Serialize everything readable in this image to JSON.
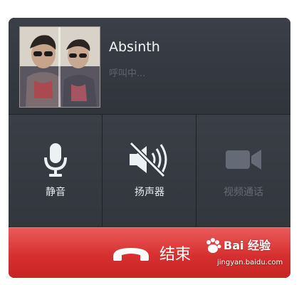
{
  "caller": {
    "name": "Absinth",
    "status": "呼叫中..."
  },
  "controls": [
    {
      "label": "静音",
      "icon": "microphone-icon",
      "enabled": true
    },
    {
      "label": "扬声器",
      "icon": "speaker-muted-icon",
      "enabled": true
    },
    {
      "label": "视频通话",
      "icon": "video-camera-icon",
      "enabled": false
    }
  ],
  "end_call": {
    "label": "结束",
    "icon": "phone-hangup-icon",
    "color": "#d93030"
  },
  "watermark": {
    "brand": "Bai 经验",
    "url": "jingyan.baidu.com"
  }
}
